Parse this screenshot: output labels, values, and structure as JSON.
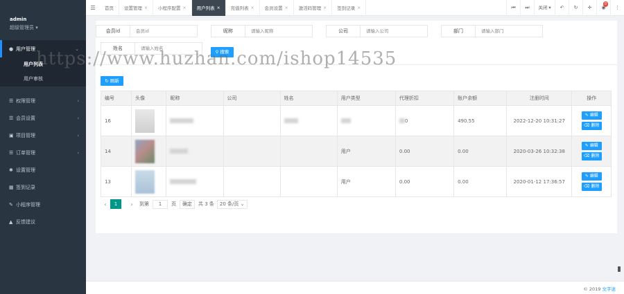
{
  "sidebar": {
    "user": "admin",
    "role": "超级管理员",
    "menus": [
      {
        "label": "用户管理",
        "icon": "user-icon",
        "expanded": true,
        "children": [
          "用户列表",
          "用户审核"
        ]
      },
      {
        "label": "权限管理",
        "icon": "list-icon"
      },
      {
        "label": "会员设置",
        "icon": "list-icon"
      },
      {
        "label": "项目管理",
        "icon": "monitor-icon"
      },
      {
        "label": "订单管理",
        "icon": "list-icon"
      },
      {
        "label": "设置管理",
        "icon": "gear-icon"
      },
      {
        "label": "签到记录",
        "icon": "calendar-icon"
      },
      {
        "label": "小程序管理",
        "icon": "edit-icon"
      },
      {
        "label": "反馈建议",
        "icon": "warning-icon"
      }
    ]
  },
  "tabs": [
    {
      "label": "首页",
      "closable": false
    },
    {
      "label": "设置管理",
      "closable": true
    },
    {
      "label": "小程序配置",
      "closable": true
    },
    {
      "label": "用户列表",
      "closable": true,
      "active": true
    },
    {
      "label": "充值列表",
      "closable": true
    },
    {
      "label": "会员设置",
      "closable": true
    },
    {
      "label": "激活码管理",
      "closable": true
    },
    {
      "label": "签到记录",
      "closable": true
    }
  ],
  "toolbar": {
    "close_label": "关闭",
    "notification_count": "0"
  },
  "filters": {
    "member_id_label": "会员id",
    "member_id_placeholder": "会员id",
    "nickname_label": "昵称",
    "nickname_placeholder": "请输入昵称",
    "company_label": "公司",
    "company_placeholder": "请输入公司",
    "department_label": "部门",
    "department_placeholder": "请输入部门",
    "name_label": "姓名",
    "name_placeholder": "请输入姓名",
    "search_label": "搜索"
  },
  "refresh_label": "刷新",
  "table": {
    "headers": [
      "编号",
      "头像",
      "昵称",
      "公司",
      "姓名",
      "用户类型",
      "代理折扣",
      "账户余额",
      "注册时间",
      "操作"
    ],
    "rows": [
      {
        "id": "16",
        "type": "",
        "discount": "0",
        "balance": "490.55",
        "time": "2022-12-20 10:31:27"
      },
      {
        "id": "14",
        "type": "用户",
        "discount": "0.00",
        "balance": "0.00",
        "time": "2020-03-26 10:32:38"
      },
      {
        "id": "13",
        "type": "用户",
        "discount": "0.00",
        "balance": "0.00",
        "time": "2020-01-12 17:36:57"
      }
    ],
    "edit_label": "编辑",
    "delete_label": "删除"
  },
  "pagination": {
    "current_page": "1",
    "goto_label": "到第",
    "page_input": "1",
    "page_unit": "页",
    "confirm_label": "确定",
    "total_label": "共 3 条",
    "page_size_label": "20 条/页"
  },
  "footer": {
    "copyright": "© 2019",
    "brand": "文字迷"
  },
  "watermark": "https://www.huzhan.com/ishop14535",
  "colors": {
    "primary": "#1e9fff",
    "sidebar": "#2a3542",
    "pager_active": "#009688",
    "badge": "#e84c3d"
  }
}
